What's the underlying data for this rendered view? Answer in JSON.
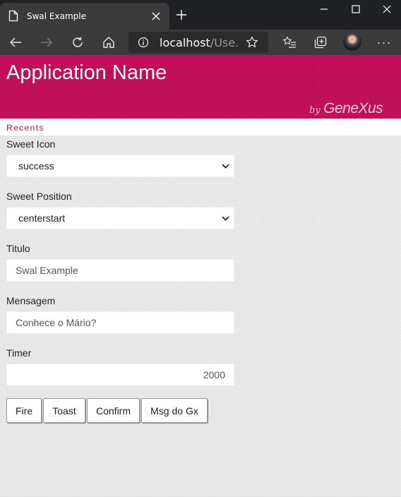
{
  "browser": {
    "tab_title": "Swal Example",
    "address_host": "localhost",
    "address_path": "/Use...",
    "more_label": "···"
  },
  "header": {
    "app_name": "Application Name",
    "brand_by": "by",
    "brand_name": "GeneXus"
  },
  "recents_label": "Recents",
  "form": {
    "sweet_icon": {
      "label": "Sweet Icon",
      "value": "success"
    },
    "sweet_position": {
      "label": "Sweet Position",
      "value": "centerstart"
    },
    "titulo": {
      "label": "Titulo",
      "value": "Swal Example"
    },
    "mensagem": {
      "label": "Mensagem",
      "value": "Conhece o Mário?"
    },
    "timer": {
      "label": "Timer",
      "value": "2000"
    }
  },
  "buttons": {
    "fire": "Fire",
    "toast": "Toast",
    "confirm": "Confirm",
    "msg_gx": "Msg do Gx"
  },
  "colors": {
    "header_bg": "#c2105a",
    "recents_text": "#b0164f",
    "chrome_dark": "#202124",
    "chrome_toolbar": "#3b3b3b"
  },
  "icons": {
    "tab": "document-icon",
    "close": "close-icon",
    "new_tab": "plus-icon",
    "back": "back-arrow-icon",
    "forward": "forward-arrow-icon",
    "refresh": "refresh-icon",
    "home": "home-icon",
    "info": "info-icon",
    "favorite": "star-icon",
    "favorites": "favorites-list-icon",
    "collections": "collections-icon",
    "dropdown": "chevron-down-icon"
  }
}
